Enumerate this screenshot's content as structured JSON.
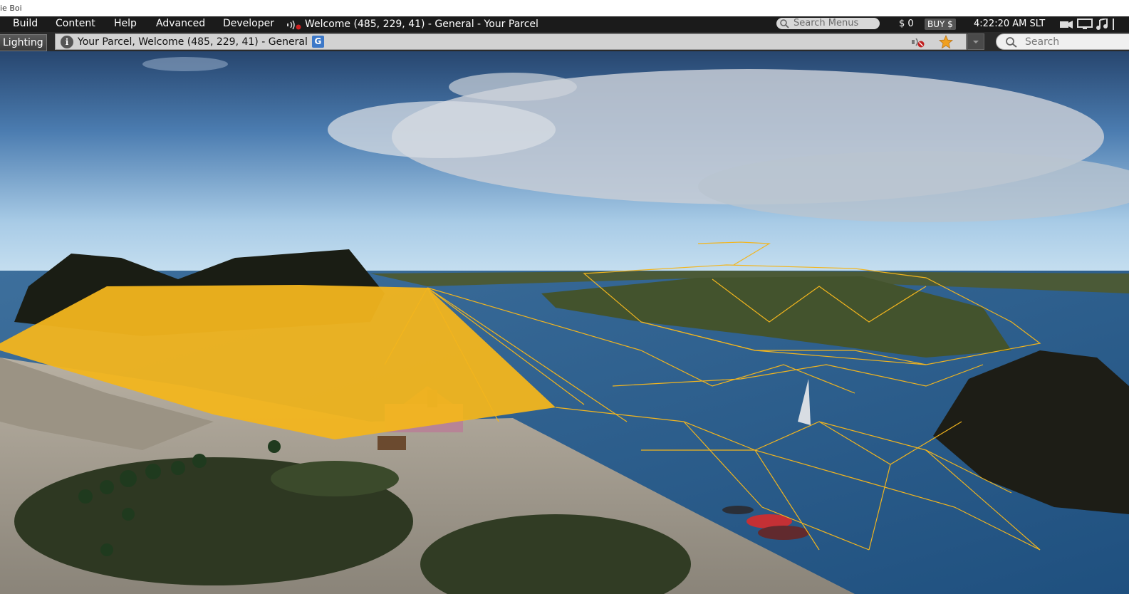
{
  "window": {
    "title_fragment": "ie Boi"
  },
  "menu": {
    "items": [
      {
        "label": "Build"
      },
      {
        "label": "Content"
      },
      {
        "label": "Help"
      },
      {
        "label": "Advanced"
      },
      {
        "label": "Developer"
      }
    ],
    "parcel_title": "Welcome (485, 229, 41) - General - Your Parcel",
    "search_menus_placeholder": "Search Menus",
    "balance": "$ 0",
    "buy_label": "BUY $",
    "clock": "4:22:20 AM SLT",
    "icons": [
      "sound-icon",
      "search-icon",
      "camera-icon",
      "monitor-icon",
      "music-icon"
    ]
  },
  "navbar": {
    "lighting_label": "Lighting",
    "location_text": "Your Parcel, Welcome (485, 229, 41) - General",
    "rating_badge": "G",
    "search_placeholder": "Search",
    "icons": [
      "info-icon",
      "voice-off-icon",
      "favorite-star-icon",
      "chevron-down-icon",
      "search-icon"
    ]
  },
  "colors": {
    "menubar_bg": "#1b1b1b",
    "mesh_lines": "#f2b51e",
    "rating_general": "#3c78c8",
    "star": "#f0a020"
  }
}
